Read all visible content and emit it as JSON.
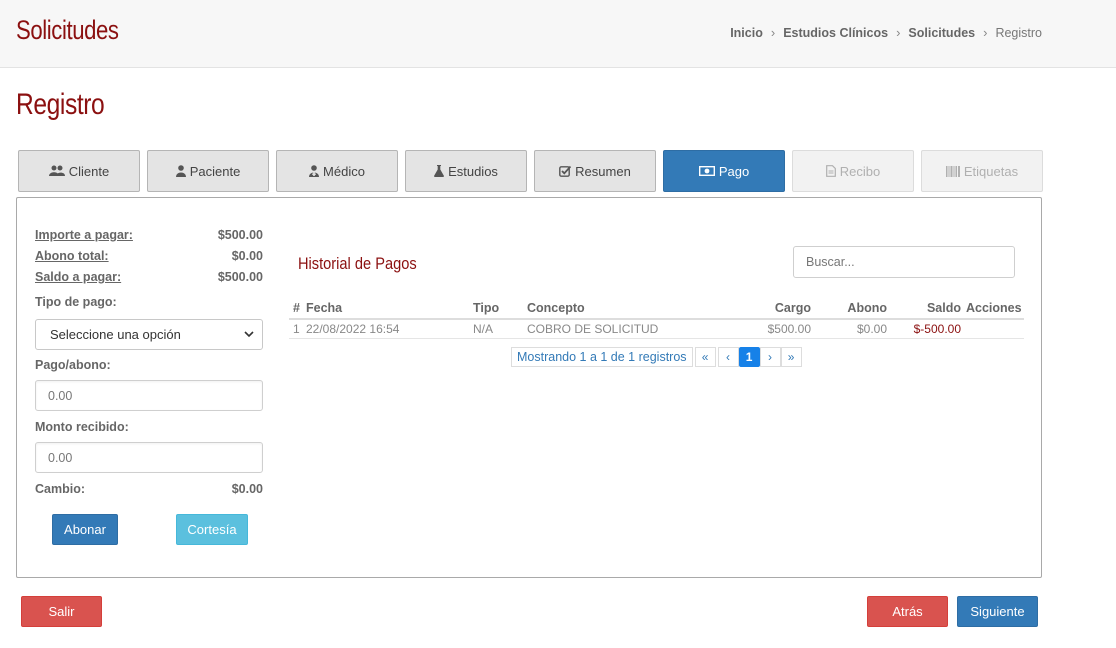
{
  "header": {
    "app_title": "Solicitudes",
    "breadcrumb": [
      "Inicio",
      "Estudios Clínicos",
      "Solicitudes",
      "Registro"
    ]
  },
  "page_title": "Registro",
  "tabs": [
    {
      "label": "Cliente",
      "icon": "users-icon",
      "state": "normal"
    },
    {
      "label": "Paciente",
      "icon": "user-icon",
      "state": "normal"
    },
    {
      "label": "Médico",
      "icon": "user-md-icon",
      "state": "normal"
    },
    {
      "label": "Estudios",
      "icon": "flask-icon",
      "state": "normal"
    },
    {
      "label": "Resumen",
      "icon": "check-square-icon",
      "state": "normal"
    },
    {
      "label": "Pago",
      "icon": "money-icon",
      "state": "active"
    },
    {
      "label": "Recibo",
      "icon": "file-icon",
      "state": "disabled"
    },
    {
      "label": "Etiquetas",
      "icon": "barcode-icon",
      "state": "disabled"
    }
  ],
  "payment": {
    "importe_label": "Importe a pagar:",
    "importe_value": "$500.00",
    "abono_label": "Abono total:",
    "abono_value": "$0.00",
    "saldo_label": "Saldo a pagar:",
    "saldo_value": "$500.00",
    "tipo_label": "Tipo de pago:",
    "tipo_selected": "Seleccione una opción",
    "pago_label": "Pago/abono:",
    "pago_placeholder": "0.00",
    "monto_label": "Monto recibido:",
    "monto_placeholder": "0.00",
    "cambio_label": "Cambio:",
    "cambio_value": "$0.00",
    "abonar_button": "Abonar",
    "cortesia_button": "Cortesía"
  },
  "history": {
    "title": "Historial de Pagos",
    "search_placeholder": "Buscar...",
    "columns": [
      "#",
      "Fecha",
      "Tipo",
      "Concepto",
      "Cargo",
      "Abono",
      "Saldo",
      "Acciones"
    ],
    "rows": [
      {
        "num": "1",
        "fecha": "22/08/2022 16:54",
        "tipo": "N/A",
        "concepto": "COBRO DE SOLICITUD",
        "cargo": "$500.00",
        "abono": "$0.00",
        "saldo": "$-500.00"
      }
    ],
    "pagination": {
      "info": "Mostrando 1 a 1 de 1 registros",
      "first": "«",
      "prev": "‹",
      "current": "1",
      "next": "›",
      "last": "»"
    }
  },
  "footer": {
    "salir_button": "Salir",
    "atras_button": "Atrás",
    "siguiente_button": "Siguiente"
  }
}
